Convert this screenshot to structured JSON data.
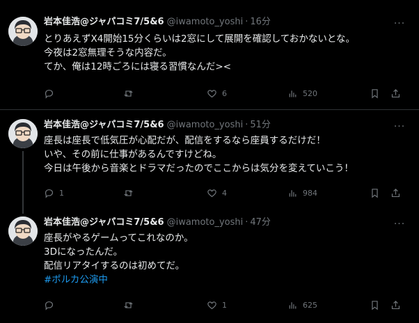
{
  "tweets": [
    {
      "name": "岩本佳浩@ジャパコミ7/5&6",
      "handle": "@iwamoto_yoshi",
      "time": "16分",
      "lines": [
        "とりあえずX4開始15分くらいは2窓にして展開を確認しておかないとな。",
        "今夜は2窓無理そうな内容だ。",
        "てか、俺は12時ごろには寝る習慣なんだ><"
      ],
      "hashtag": "",
      "reply_count": "",
      "retweet_count": "",
      "like_count": "6",
      "view_count": "520"
    },
    {
      "name": "岩本佳浩@ジャパコミ7/5&6",
      "handle": "@iwamoto_yoshi",
      "time": "51分",
      "lines": [
        "座長は座長で低気圧が心配だが、配信をするなら座員するだけだ！",
        "いや、その前に仕事があるんですけどね。",
        "今日は午後から音楽とドラマだったのでここからは気分を変えていこう！"
      ],
      "hashtag": "",
      "reply_count": "1",
      "retweet_count": "",
      "like_count": "4",
      "view_count": "984"
    },
    {
      "name": "岩本佳浩@ジャパコミ7/5&6",
      "handle": "@iwamoto_yoshi",
      "time": "47分",
      "lines": [
        "座長がやるゲームってこれなのか。",
        " 3Dになったんだ。",
        "配信リアタイするのは初めてだ。"
      ],
      "hashtag": "#ポルカ公演中",
      "reply_count": "",
      "retweet_count": "",
      "like_count": "1",
      "view_count": "625"
    }
  ],
  "more_label": "···",
  "dot_separator": "·",
  "icons": [
    "avatar",
    "more-icon",
    "reply-icon",
    "retweet-icon",
    "like-icon",
    "views-icon",
    "bookmark-icon",
    "share-icon"
  ],
  "colors": {
    "background": "#000000",
    "text": "#e7e9ea",
    "muted": "#71767b",
    "link": "#1d9bf0",
    "divider": "#2f3336"
  }
}
